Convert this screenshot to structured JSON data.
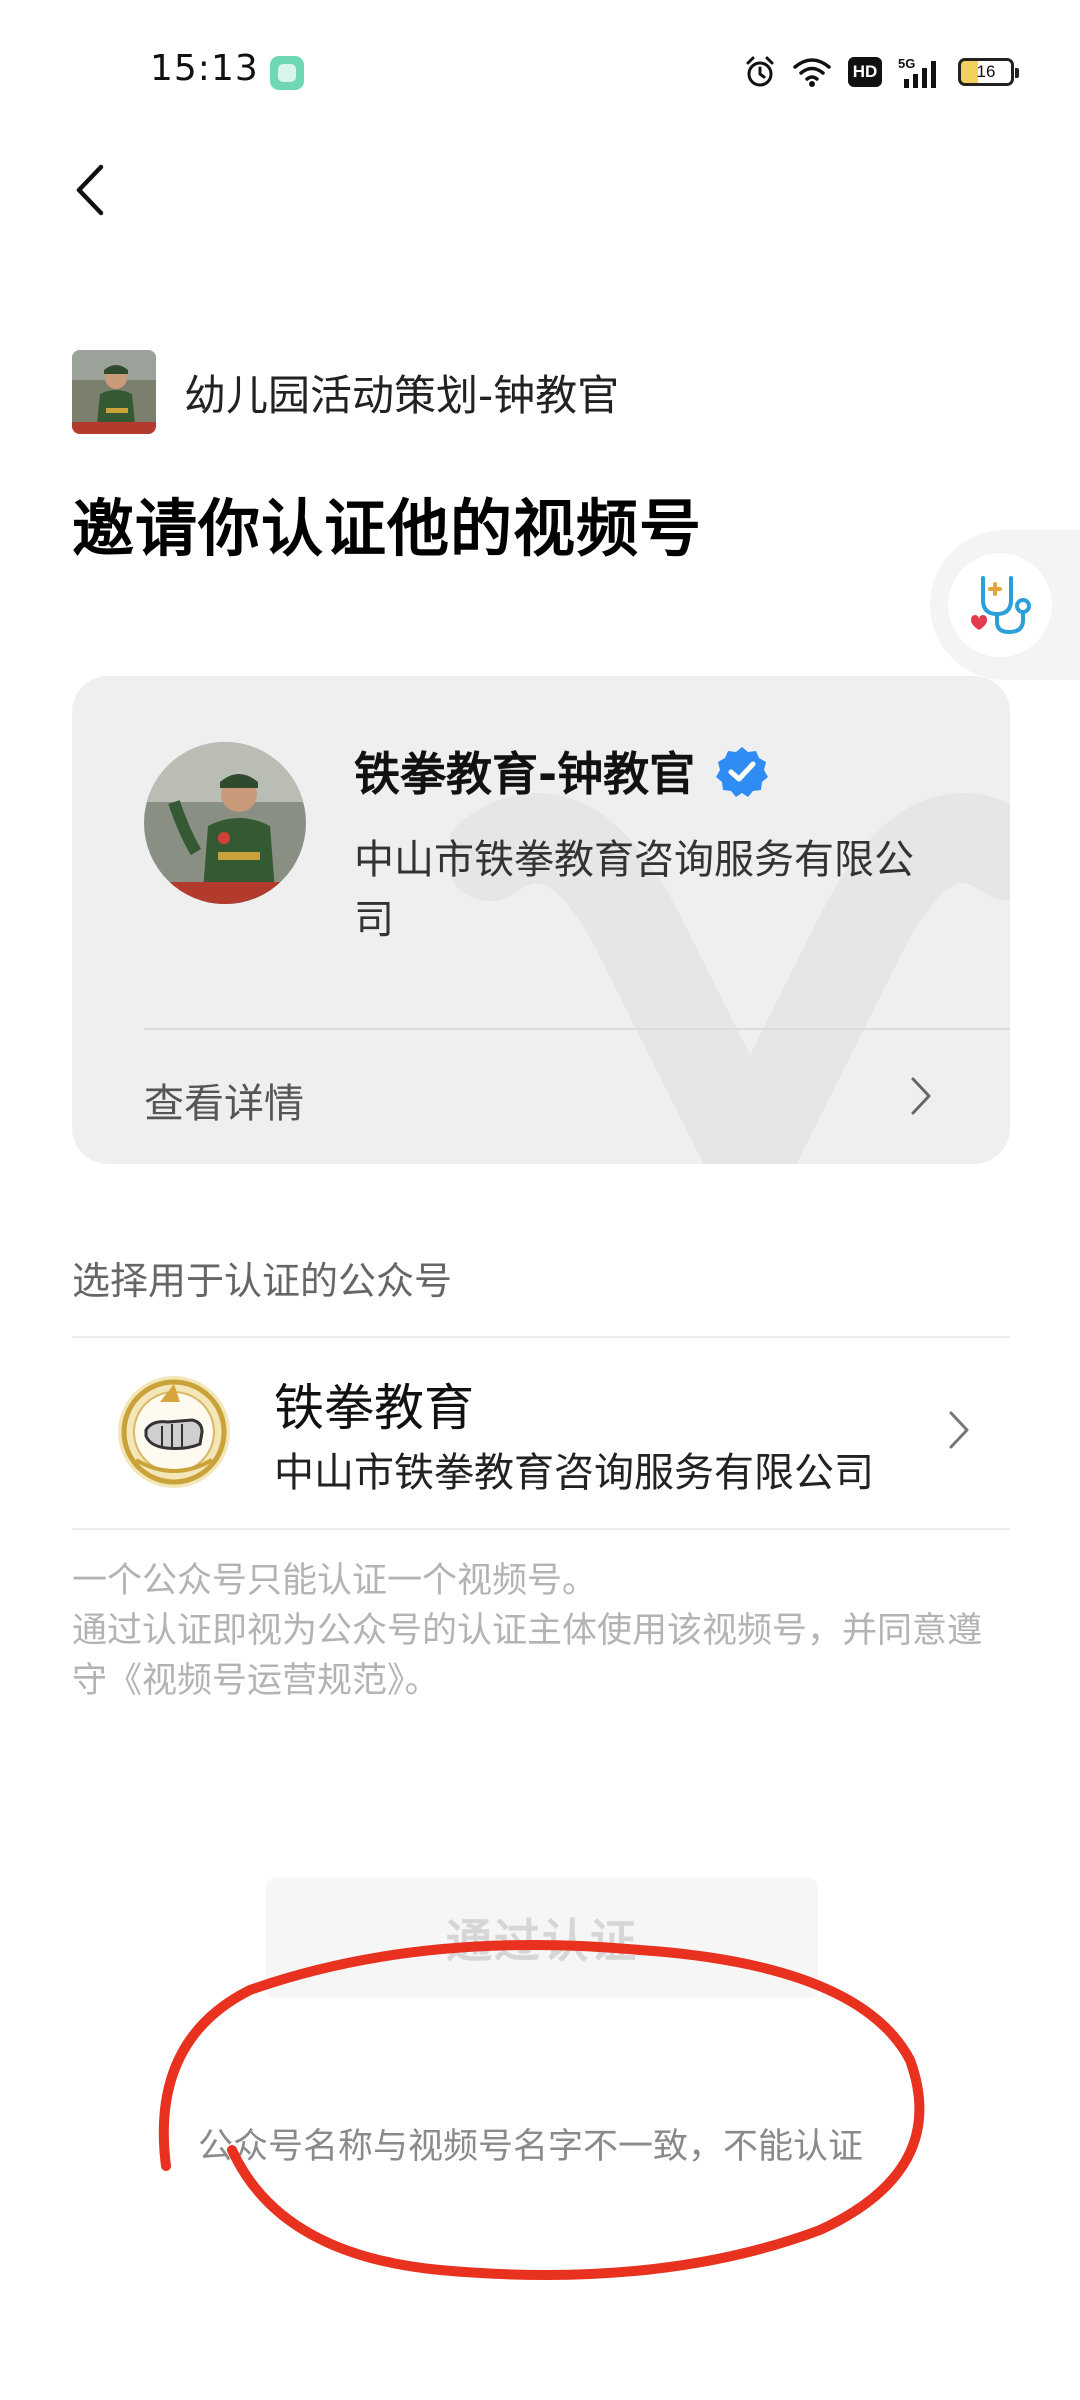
{
  "status_bar": {
    "time": "15:13",
    "network": "5G",
    "hd": "HD",
    "battery": "16"
  },
  "header": {
    "back_icon": "chevron-left-icon"
  },
  "inviter": {
    "name": "幼儿园活动策划-钟教官"
  },
  "title": "邀请你认证他的视频号",
  "account_card": {
    "name": "铁拳教育-钟教官",
    "verified_icon": "verified-badge-icon",
    "company": "中山市铁拳教育咨询服务有限公司",
    "details_label": "查看详情"
  },
  "select_section": {
    "label": "选择用于认证的公众号",
    "official_account": {
      "name": "铁拳教育",
      "company": "中山市铁拳教育咨询服务有限公司"
    }
  },
  "note": {
    "line1": "一个公众号只能认证一个视频号。",
    "line2": "通过认证即视为公众号的认证主体使用该视频号，并同意遵守《视频号运营规范》。"
  },
  "confirm_button": {
    "label": "通过认证"
  },
  "error_text": "公众号名称与视频号名字不一致，不能认证",
  "colors": {
    "verified_blue": "#2f8cf5",
    "annotation_red": "#e8311f",
    "button_disabled_text": "#d6d6d6"
  }
}
